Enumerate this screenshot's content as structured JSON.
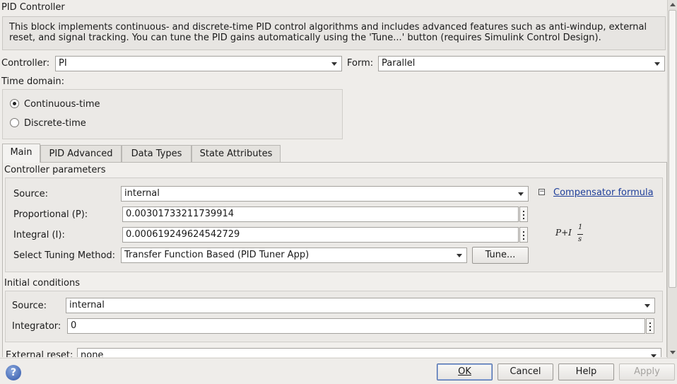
{
  "window_title": "PID Controller",
  "description": "This block implements continuous- and discrete-time PID control algorithms and includes advanced features such as anti-windup, external reset, and signal tracking. You can tune the PID gains automatically using the 'Tune...' button (requires Simulink Control Design).",
  "controller": {
    "label": "Controller:",
    "value": "PI"
  },
  "form": {
    "label": "Form:",
    "value": "Parallel"
  },
  "time_domain": {
    "label": "Time domain:",
    "options": [
      {
        "label": "Continuous-time",
        "selected": true
      },
      {
        "label": "Discrete-time",
        "selected": false
      }
    ]
  },
  "tabs": [
    "Main",
    "PID Advanced",
    "Data Types",
    "State Attributes"
  ],
  "controller_parameters": {
    "title": "Controller parameters",
    "source": {
      "label": "Source:",
      "value": "internal"
    },
    "proportional": {
      "label": "Proportional (P):",
      "value": "0.00301733211739914"
    },
    "integral": {
      "label": "Integral (I):",
      "value": "0.000619249624542729"
    },
    "tuning": {
      "label": "Select Tuning Method:",
      "value": "Transfer Function Based (PID Tuner App)"
    },
    "tune_button": "Tune...",
    "compensator_link": "Compensator formula",
    "collapse_symbol": "−",
    "formula": {
      "prefix": "P+I",
      "numerator": "1",
      "denominator": "s"
    }
  },
  "initial_conditions": {
    "title": "Initial conditions",
    "source": {
      "label": "Source:",
      "value": "internal"
    },
    "integrator": {
      "label": "Integrator:",
      "value": "0"
    }
  },
  "external_reset": {
    "label": "External reset:",
    "value": "none"
  },
  "buttons": {
    "help_icon": "?",
    "ok": "OK",
    "cancel": "Cancel",
    "help": "Help",
    "apply": "Apply"
  }
}
